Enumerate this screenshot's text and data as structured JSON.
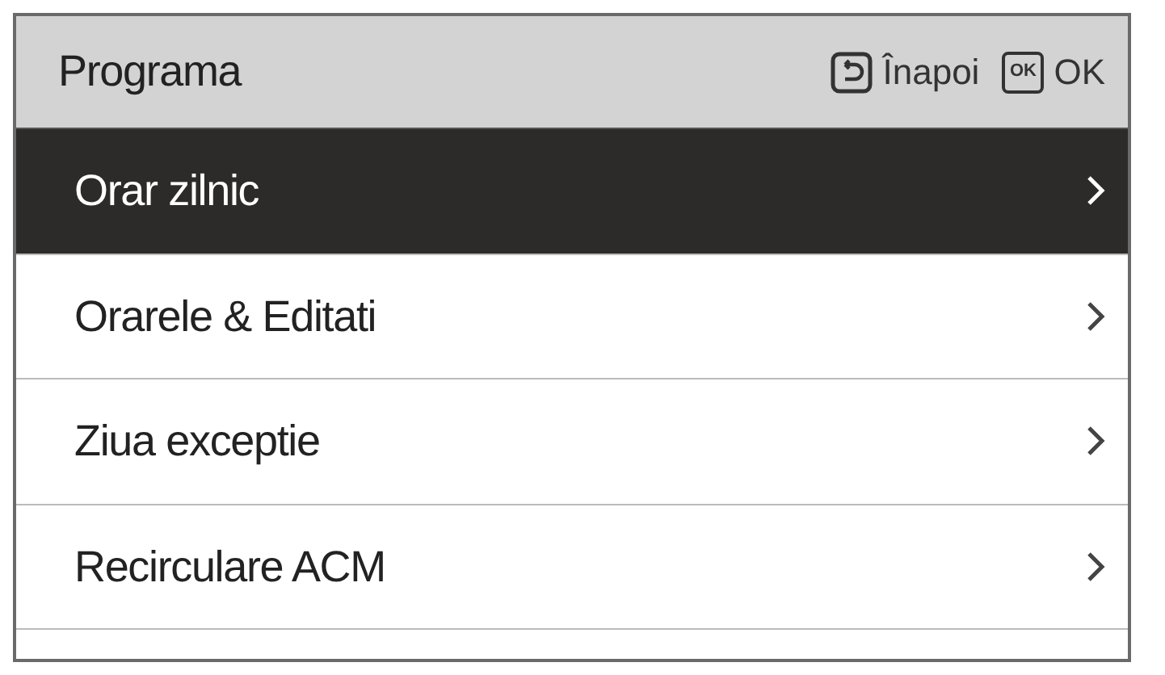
{
  "header": {
    "title": "Programa",
    "actions": [
      {
        "kind": "back",
        "label": "Înapoi"
      },
      {
        "kind": "ok",
        "key_label": "OK",
        "label": "OK"
      }
    ]
  },
  "menu": [
    {
      "label": "Orar zilnic",
      "selected": true
    },
    {
      "label": "Orarele & Editati",
      "selected": false
    },
    {
      "label": "Ziua exceptie",
      "selected": false
    },
    {
      "label": "Recirculare ACM",
      "selected": false
    }
  ]
}
